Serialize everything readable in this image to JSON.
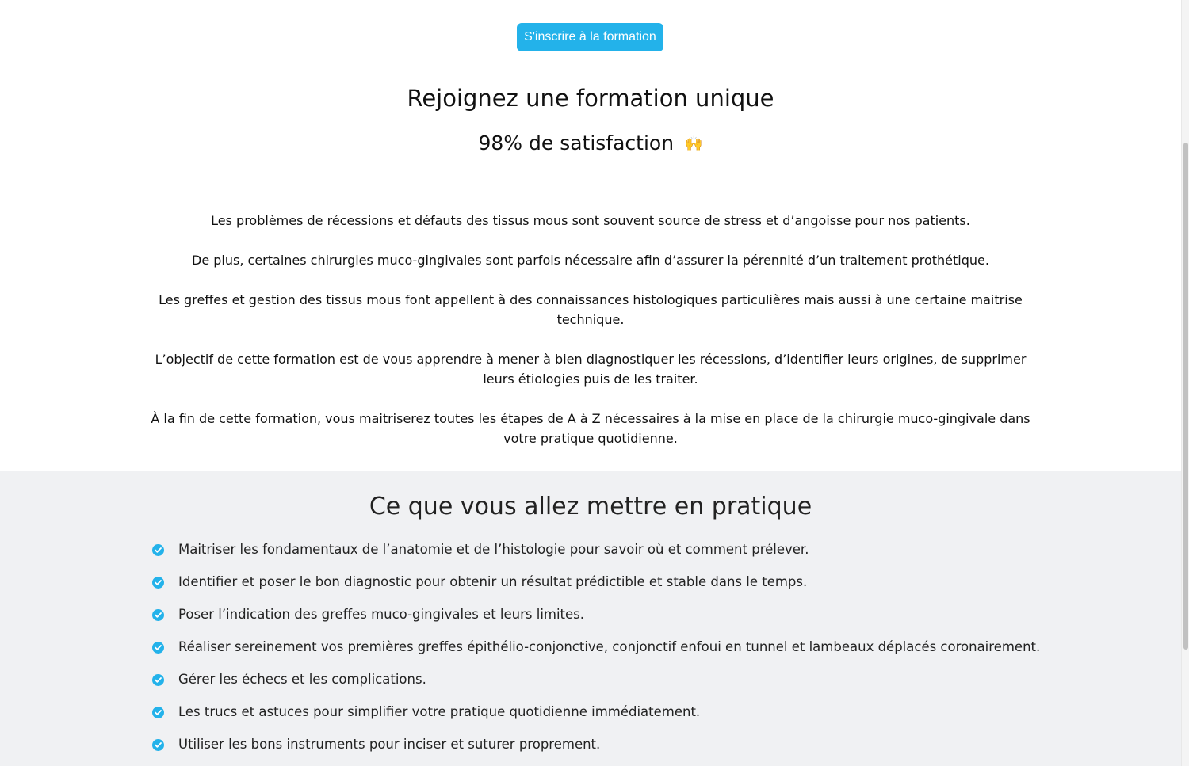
{
  "cta": {
    "label": "S'inscrire à la formation"
  },
  "hero": {
    "title": "Rejoignez une formation unique",
    "subtitle": "98% de satisfaction",
    "emoji": "🙌",
    "emoji_icon": "raised-hands-icon"
  },
  "intro": {
    "paragraphs": [
      "Les problèmes de récessions et défauts des tissus mous sont souvent source de stress et d’angoisse pour nos patients.",
      "De plus, certaines chirurgies muco-gingivales sont parfois nécessaire afin d’assurer la pérennité d’un traitement prothétique.",
      "Les greffes et gestion des tissus mous font appellent à des connaissances histologiques particulières mais aussi à une certaine maitrise technique.",
      "L’objectif de cette formation est de vous apprendre à mener à bien diagnostiquer les récessions, d’identifier leurs origines, de supprimer leurs étiologies puis de les traiter.",
      "À la fin de cette formation, vous maitriserez toutes les étapes de A à Z nécessaires à la mise en place de la chirurgie muco-gingivale dans votre pratique quotidienne."
    ]
  },
  "practice": {
    "title": "Ce que vous allez mettre en pratique",
    "items": [
      "Maitriser les fondamentaux de l’anatomie et de l’histologie pour savoir où et comment prélever.",
      "Identifier et poser le bon diagnostic pour obtenir un résultat prédictible et stable dans le temps.",
      "Poser l’indication des greffes muco-gingivales et leurs limites.",
      "Réaliser sereinement vos premières greffes épithélio-conjonctive, conjonctif enfoui en tunnel et lambeaux déplacés coronairement.",
      "Gérer les échecs et les complications.",
      "Les trucs et astuces pour simplifier votre pratique quotidienne immédiatement.",
      "Utiliser les bons instruments pour inciser et suturer proprement."
    ]
  },
  "colors": {
    "accent": "#23b2ea",
    "section_background": "#f0f1f3",
    "text": "#111111"
  }
}
